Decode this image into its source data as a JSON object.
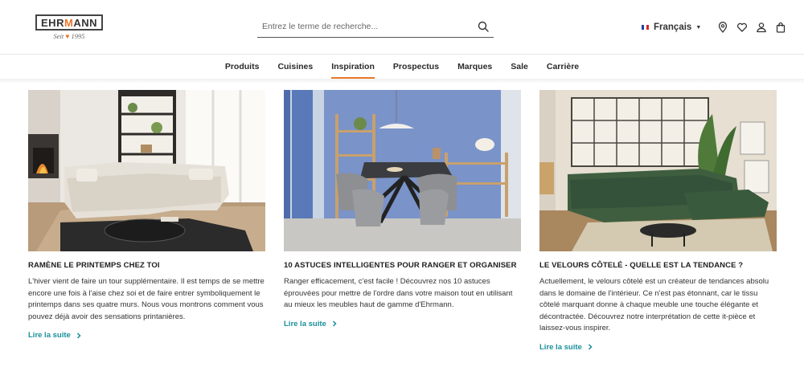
{
  "brand": {
    "logo_text_prefix": "EHR",
    "logo_text_m": "M",
    "logo_text_suffix": "ANN",
    "logo_sub_left": "Seit",
    "logo_sub_right": "1995"
  },
  "search": {
    "placeholder": "Entrez le terme de recherche...",
    "icon": "search-icon"
  },
  "utility": {
    "language": "Français",
    "icons": [
      "location-pin-icon",
      "heart-icon",
      "user-icon",
      "shopping-bag-icon"
    ]
  },
  "nav": {
    "items": [
      "Produits",
      "Cuisines",
      "Inspiration",
      "Prospectus",
      "Marques",
      "Sale",
      "Carrière"
    ],
    "active": "Inspiration"
  },
  "colors": {
    "accent": "#e9772a",
    "link": "#1a8f9c"
  },
  "articles": [
    {
      "title": "RAMÈNE LE PRINTEMPS CHEZ TOI",
      "text": "L'hiver vient de faire un tour supplémentaire. Il est temps de se mettre encore une fois à l'aise chez soi et de faire entrer symboliquement le printemps dans ses quatre murs. Nous vous montrons comment vous pouvez déjà avoir des sensations printanières.",
      "link": "Lire la suite"
    },
    {
      "title": "10 ASTUCES INTELLIGENTES POUR RANGER ET ORGANISER",
      "text": "Ranger efficacement, c'est facile ! Découvrez nos 10 astuces éprouvées pour mettre de l'ordre dans votre maison tout en utilisant au mieux les meubles haut de gamme d'Ehrmann.",
      "link": "Lire la suite"
    },
    {
      "title": "LE VELOURS CÔTELÉ - QUELLE EST LA TENDANCE ?",
      "text": "Actuellement, le velours côtelé est un créateur de tendances absolu dans le domaine de l'intérieur. Ce n'est pas étonnant, car le tissu côtelé marquant donne à chaque meuble une touche élégante et décontractée. Découvrez notre interprétation de cette it-pièce et laissez-vous inspirer.",
      "link": "Lire la suite"
    }
  ]
}
